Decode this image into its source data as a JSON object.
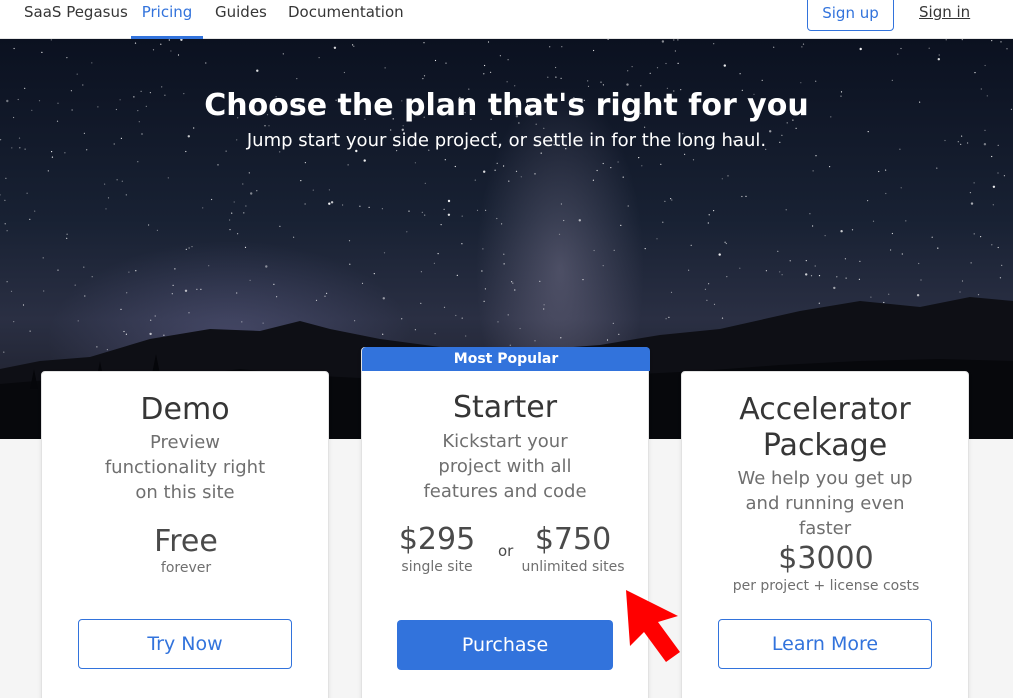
{
  "nav": {
    "brand": "SaaS Pegasus",
    "links": [
      "Pricing",
      "Guides",
      "Documentation"
    ],
    "signup": "Sign up",
    "signin": "Sign in"
  },
  "hero": {
    "title": "Choose the plan that's right for you",
    "subtitle": "Jump start your side project, or settle in for the long haul."
  },
  "plans": {
    "demo": {
      "name": "Demo",
      "desc": [
        "Preview",
        "functionality right",
        "on this site"
      ],
      "price": "Free",
      "price_note": "forever",
      "button": "Try Now"
    },
    "starter": {
      "badge": "Most Popular",
      "name": "Starter",
      "desc": [
        "Kickstart your",
        "project with all",
        "features and code"
      ],
      "price_single": "$295",
      "note_single": "single site",
      "or": "or",
      "price_unlimited": "$750",
      "note_unlimited": "unlimited sites",
      "button": "Purchase"
    },
    "accelerator": {
      "name_line1": "Accelerator",
      "name_line2": "Package",
      "desc": [
        "We help you get up",
        "and running even",
        "faster"
      ],
      "price": "$3000",
      "price_note": "per project + license costs",
      "button": "Learn More"
    }
  },
  "colors": {
    "accent": "#3273dc",
    "annotation_arrow": "#ff0000"
  }
}
